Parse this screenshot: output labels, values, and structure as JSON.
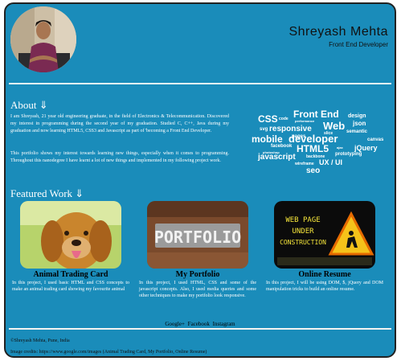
{
  "header": {
    "name": "Shreyash Mehta",
    "role": "Front End Developer"
  },
  "about": {
    "title": "About ⇓",
    "paragraph1": "I am Shreyash, 21 year old engineering graduate, in the field of Electronics & Telecommunication. Discovered my interest in programming during the second year of my graduation. Studied C, C++, Java during my graduation and now learning HTML5, CSS3 and Javascript as part of 'becoming a Front End Developer.",
    "paragraph2": "This portfolio shows my interest towards learning new things, especially when it comes to programming. Throughout this nanodegree I have learnt a lot of new things and implemented in my following project work.",
    "word_cloud": [
      "CSS",
      "code",
      "performance",
      "Front End",
      "design",
      "svg",
      "responsive",
      "Web",
      "json",
      "pages",
      "slice",
      "semantic",
      "mobile",
      "developer",
      "canvas",
      "facebook",
      "HTML5",
      "ajax",
      "jQuery",
      "photoshop",
      "backbone",
      "prototyping",
      "javascript",
      "wireframe",
      "UX / UI",
      "seo"
    ]
  },
  "featured": {
    "title": "Featured Work ⇓",
    "cards": [
      {
        "title": "Animal Trading Card",
        "desc": "In this project, I used basic HTML and CSS concepts to make an animal trading card showing my favourite animal"
      },
      {
        "title": "My Portfolio",
        "desc": "In this project, I used HTML, CSS and some of the javascript concepts. Also, I used media queries and some other techniques to make my portfolio look responsive."
      },
      {
        "title": "Online Resume",
        "desc": "In this project, I will be using DOM, $, jQuery and DOM manipulation tricks to build an online resume."
      }
    ],
    "portfolio_image_text": "PORTFOLIO",
    "resume_image_text": [
      "WEB PAGE",
      "UNDER",
      "CONSTRUCTION"
    ]
  },
  "footer": {
    "links": [
      "Google+",
      "Facebook",
      "Instagram"
    ],
    "copyright": "©Shreyash Mehta, Pune, India",
    "credits": "Image credits: https://www.google.com/images (Animal Trading Card, My Portfolio, Online Resume)"
  },
  "colors": {
    "background": "#1a8cba",
    "text": "#ffffff"
  }
}
